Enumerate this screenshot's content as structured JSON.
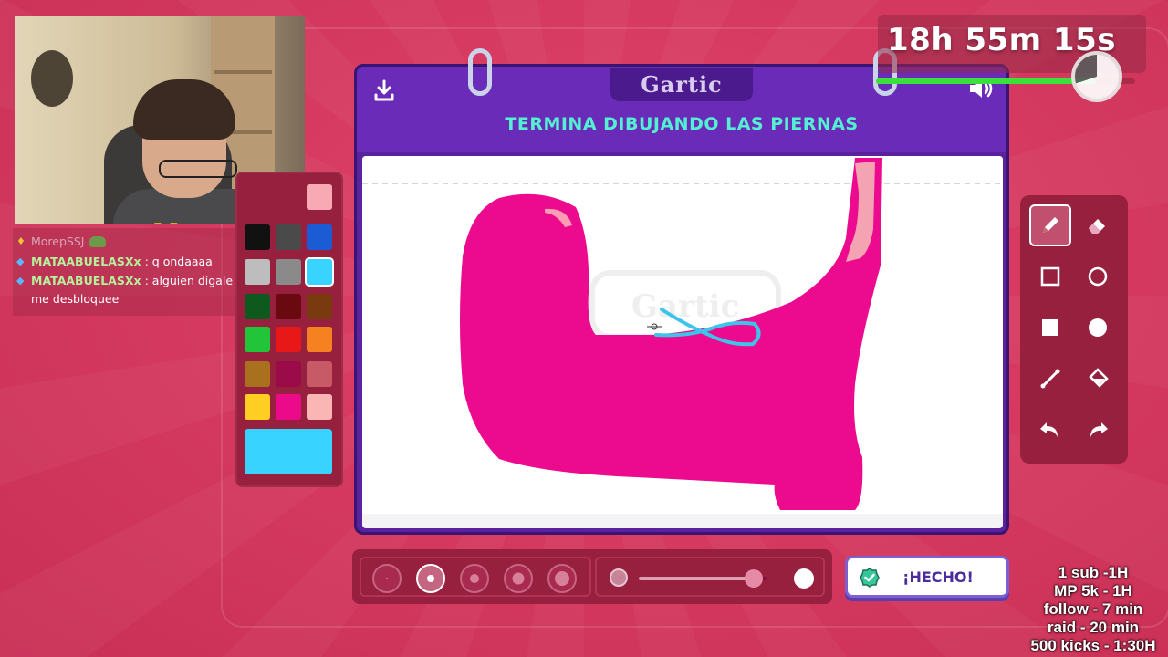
{
  "timer": {
    "text": "18h 55m 15s",
    "progress": 0.85,
    "clock_fraction": 0.7
  },
  "chat": [
    {
      "user": "MorepSSJ",
      "message": "",
      "faded": true
    },
    {
      "user": "MATAABUELASXx",
      "message": ": q ondaaaa"
    },
    {
      "user": "MATAABUELASXx",
      "message": ": alguien dígale a Bianca q me desbloquee"
    }
  ],
  "game": {
    "logo": "Gartic",
    "instruction": "TERMINA DIBUJANDO LAS PIERNAS",
    "done_label": "¡HECHO!",
    "selected_color": "#38d4ff",
    "brush_size_index": 1,
    "opacity": 0.9
  },
  "palette": {
    "colors": [
      [
        "#f7a9b4"
      ],
      [
        "#111111",
        "#4a4a4a",
        "#1b5cd4"
      ],
      [
        "#bdbdbd",
        "#8a8a8a",
        "#38d4ff"
      ],
      [
        "#0e5a1e",
        "#6a0a10",
        "#7a3a10"
      ],
      [
        "#22c43a",
        "#e81818",
        "#f58120"
      ],
      [
        "#a9701e",
        "#9b0b4a",
        "#c85a68"
      ],
      [
        "#ffce22",
        "#ea0a8a",
        "#fab6b4"
      ]
    ],
    "big": "#38d4ff"
  },
  "tools": [
    {
      "name": "pencil-tool",
      "icon": "pencil-icon",
      "selected": true
    },
    {
      "name": "eraser-tool",
      "icon": "eraser-icon"
    },
    {
      "name": "rectangle-tool",
      "icon": "rectangle-outline-icon"
    },
    {
      "name": "ellipse-tool",
      "icon": "circle-outline-icon"
    },
    {
      "name": "filled-rectangle-tool",
      "icon": "filled-square-icon"
    },
    {
      "name": "filled-ellipse-tool",
      "icon": "filled-circle-icon"
    },
    {
      "name": "line-tool",
      "icon": "line-icon"
    },
    {
      "name": "fill-tool",
      "icon": "paint-bucket-icon"
    },
    {
      "name": "undo-tool",
      "icon": "undo-icon"
    },
    {
      "name": "redo-tool",
      "icon": "redo-icon"
    }
  ],
  "goals": [
    "1 sub -1H",
    "MP 5k - 1H",
    "follow - 7 min",
    "raid - 20 min",
    "500 kicks - 1:30H"
  ]
}
